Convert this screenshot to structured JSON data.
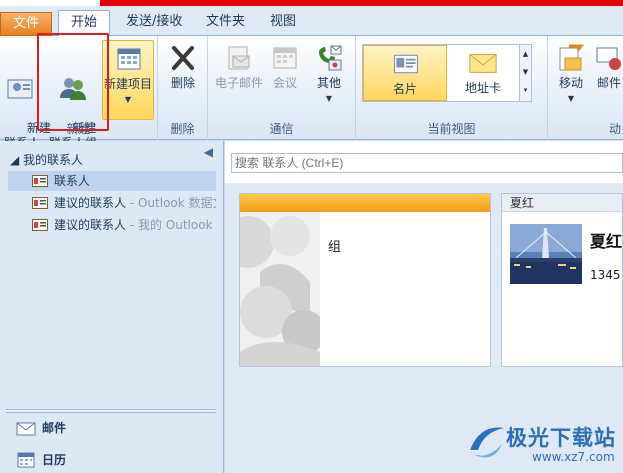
{
  "tabs": {
    "file": "文件",
    "home": "开始",
    "send_receive": "发送/接收",
    "folder": "文件夹",
    "view": "视图"
  },
  "ribbon": {
    "new_group": {
      "label": "新建",
      "new_contact": "新建\n联系人",
      "new_contact_group": "新建\n联系人组",
      "new_items": "新建项目"
    },
    "delete_group": {
      "label": "删除",
      "delete": "删除"
    },
    "communicate_group": {
      "label": "通信",
      "email": "电子邮件",
      "meeting": "会议",
      "more": "其他"
    },
    "current_view_group": {
      "label": "当前视图",
      "business_card": "名片",
      "address_card": "地址卡"
    },
    "actions_group": {
      "label": "动",
      "move": "移动",
      "mail_merge": "邮件"
    }
  },
  "left_pane": {
    "header": "我的联系人",
    "items": [
      {
        "label": "联系人",
        "suffix": ""
      },
      {
        "label": "建议的联系人",
        "suffix": " - Outlook 数据文"
      },
      {
        "label": "建议的联系人",
        "suffix": " - 我的 Outlook"
      }
    ],
    "nav": {
      "mail": "邮件",
      "calendar": "日历"
    }
  },
  "main": {
    "search_placeholder": "搜索 联系人 (Ctrl+E)",
    "cards": [
      {
        "header": "",
        "name": "组"
      },
      {
        "header": "夏红",
        "name": "夏红",
        "phone": "1345"
      }
    ]
  },
  "watermark": {
    "text": "极光下载站",
    "url": "www.xz7.com"
  },
  "colors": {
    "accent_orange": "#f19d14",
    "highlight": "#ffd75e",
    "annotation_red": "#e01b1b"
  }
}
